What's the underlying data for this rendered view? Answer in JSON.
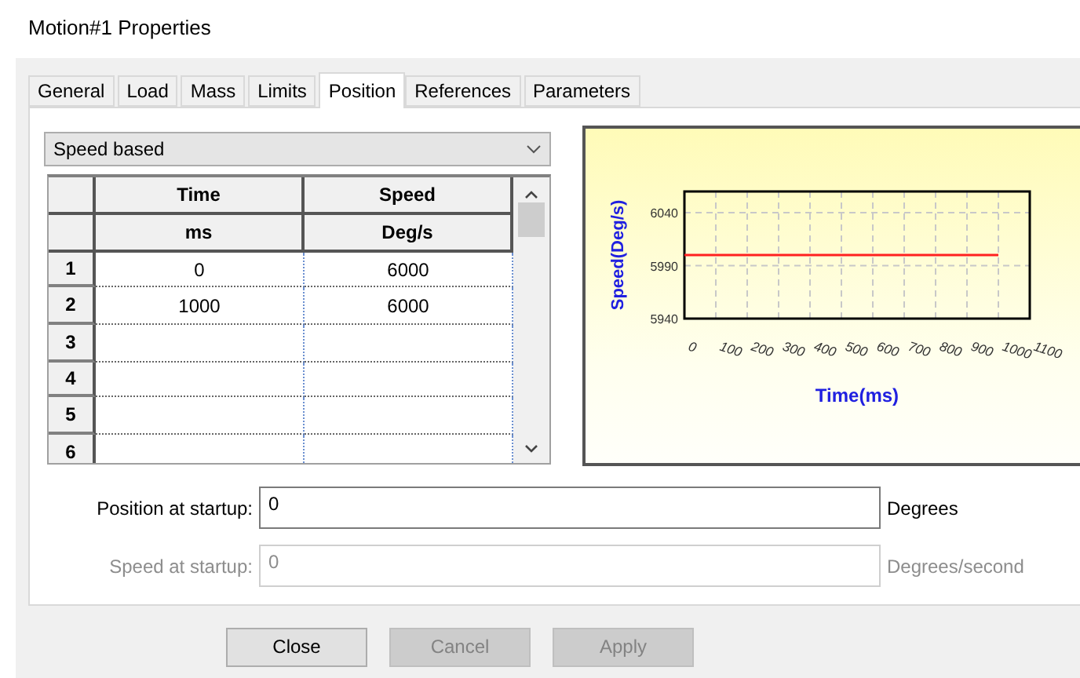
{
  "window": {
    "title": "Motion#1 Properties"
  },
  "tabs": [
    {
      "label": "General",
      "selected": false
    },
    {
      "label": "Load",
      "selected": false
    },
    {
      "label": "Mass",
      "selected": false
    },
    {
      "label": "Limits",
      "selected": false
    },
    {
      "label": "Position",
      "selected": true
    },
    {
      "label": "References",
      "selected": false
    },
    {
      "label": "Parameters",
      "selected": false
    }
  ],
  "mode_select": {
    "value": "Speed based"
  },
  "table": {
    "columns": [
      {
        "label": "Time",
        "unit": "ms"
      },
      {
        "label": "Speed",
        "unit": "Deg/s"
      }
    ],
    "rows": [
      {
        "index": "1",
        "cells": [
          "0",
          "6000"
        ]
      },
      {
        "index": "2",
        "cells": [
          "1000",
          "6000"
        ]
      },
      {
        "index": "3",
        "cells": [
          "",
          ""
        ]
      },
      {
        "index": "4",
        "cells": [
          "",
          ""
        ]
      },
      {
        "index": "5",
        "cells": [
          "",
          ""
        ]
      },
      {
        "index": "6",
        "cells": [
          "",
          ""
        ]
      }
    ]
  },
  "chart": {
    "chart_data": {
      "type": "line",
      "xlabel": "Time(ms)",
      "ylabel": "Speed(Deg/s)",
      "x": [
        0,
        1000
      ],
      "grid": true,
      "series": [
        {
          "color": "#ff2020",
          "values": [
            6000,
            6000
          ]
        }
      ],
      "xlim": [
        0,
        1100
      ],
      "ylim": [
        5940,
        6060
      ],
      "xticks": [
        0,
        100,
        200,
        300,
        400,
        500,
        600,
        700,
        800,
        900,
        1000,
        1100
      ],
      "yticks": [
        5940,
        5990,
        6040
      ]
    }
  },
  "fields": [
    {
      "label": "Position at startup:",
      "value": "0",
      "unit": "Degrees",
      "disabled": false
    },
    {
      "label": "Speed at startup:",
      "value": "0",
      "unit": "Degrees/second",
      "disabled": true
    }
  ],
  "buttons": [
    {
      "label": "Close",
      "disabled": false
    },
    {
      "label": "Cancel",
      "disabled": true
    },
    {
      "label": "Apply",
      "disabled": true
    }
  ]
}
